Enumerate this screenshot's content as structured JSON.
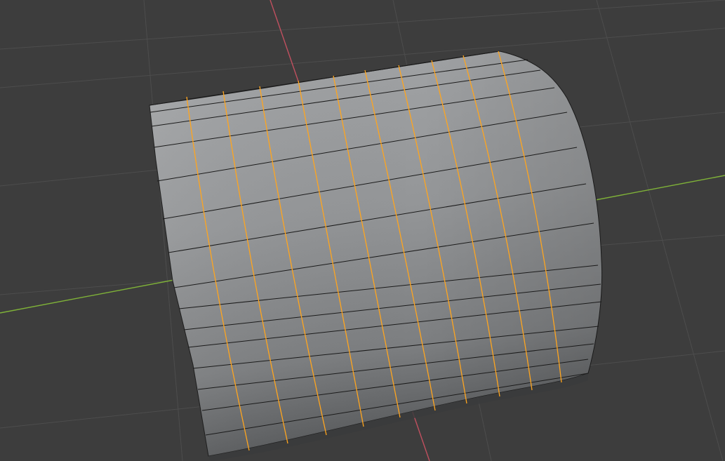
{
  "viewport": {
    "mode": "edit",
    "object": "cylinder",
    "colors": {
      "background": "#3d3d3d",
      "grid_line": "#4d4d4d",
      "x_axis": "#c0505f",
      "y_axis": "#7fb238",
      "face_light": "#9b9d9f",
      "face_mid": "#8a8c8e",
      "face_dark": "#56585a",
      "edge": "#1a1a1a",
      "selected_edge": "#ffa51e"
    },
    "mesh": {
      "horizontal_segments": 16,
      "loop_cuts_selected": 10
    }
  }
}
